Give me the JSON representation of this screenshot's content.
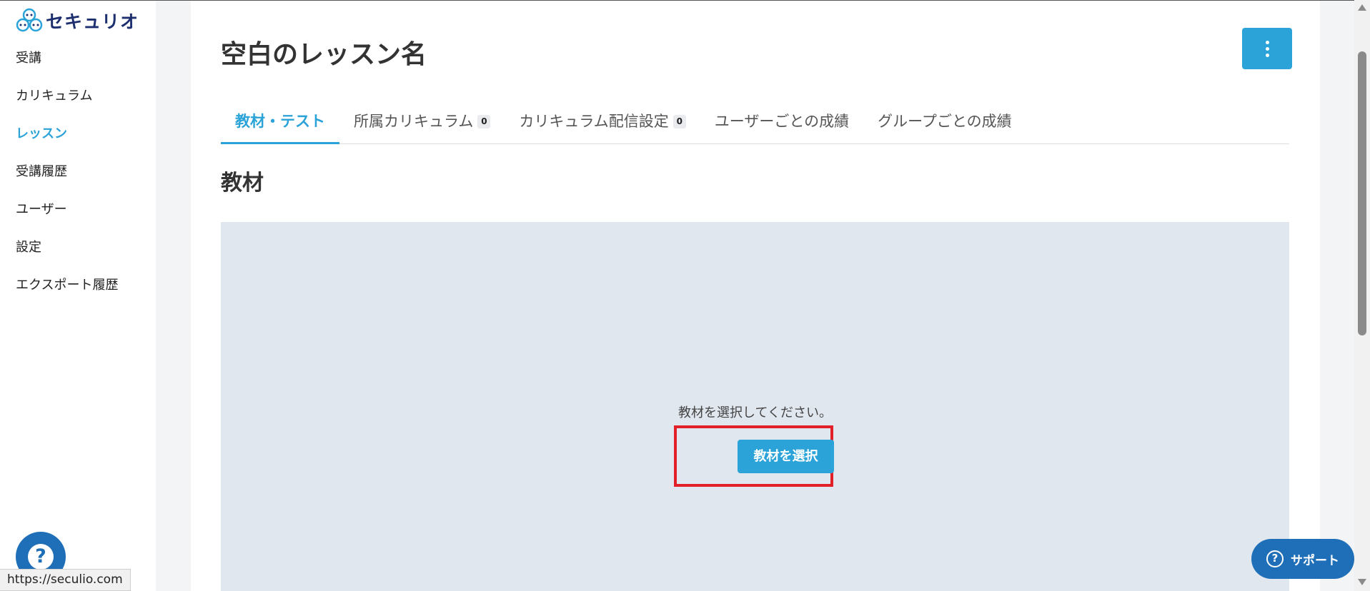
{
  "brand": {
    "name": "セキュリオ"
  },
  "sidebar": {
    "items": [
      {
        "label": "受講",
        "active": false
      },
      {
        "label": "カリキュラム",
        "active": false
      },
      {
        "label": "レッスン",
        "active": true
      },
      {
        "label": "受講履歴",
        "active": false
      },
      {
        "label": "ユーザー",
        "active": false
      },
      {
        "label": "設定",
        "active": false
      },
      {
        "label": "エクスポート履歴",
        "active": false
      }
    ],
    "help_icon": "question-circle-icon",
    "url_hint": "https://seculio.com"
  },
  "page": {
    "title": "空白のレッスン名",
    "menu_icon": "more-vertical-icon"
  },
  "tabs": [
    {
      "label": "教材・テスト",
      "active": true
    },
    {
      "label": "所属カリキュラム",
      "count": "0"
    },
    {
      "label": "カリキュラム配信設定",
      "count": "0"
    },
    {
      "label": "ユーザーごとの成績"
    },
    {
      "label": "グループごとの成績"
    }
  ],
  "section": {
    "title": "教材",
    "empty_message": "教材を選択してください。",
    "select_button": "教材を選択"
  },
  "support": {
    "label": "サポート",
    "icon": "question-circle-icon"
  },
  "colors": {
    "accent": "#2ba3d9",
    "support": "#1f6fb8",
    "empty_bg": "#e1e7ef",
    "highlight": "#e2202a"
  }
}
